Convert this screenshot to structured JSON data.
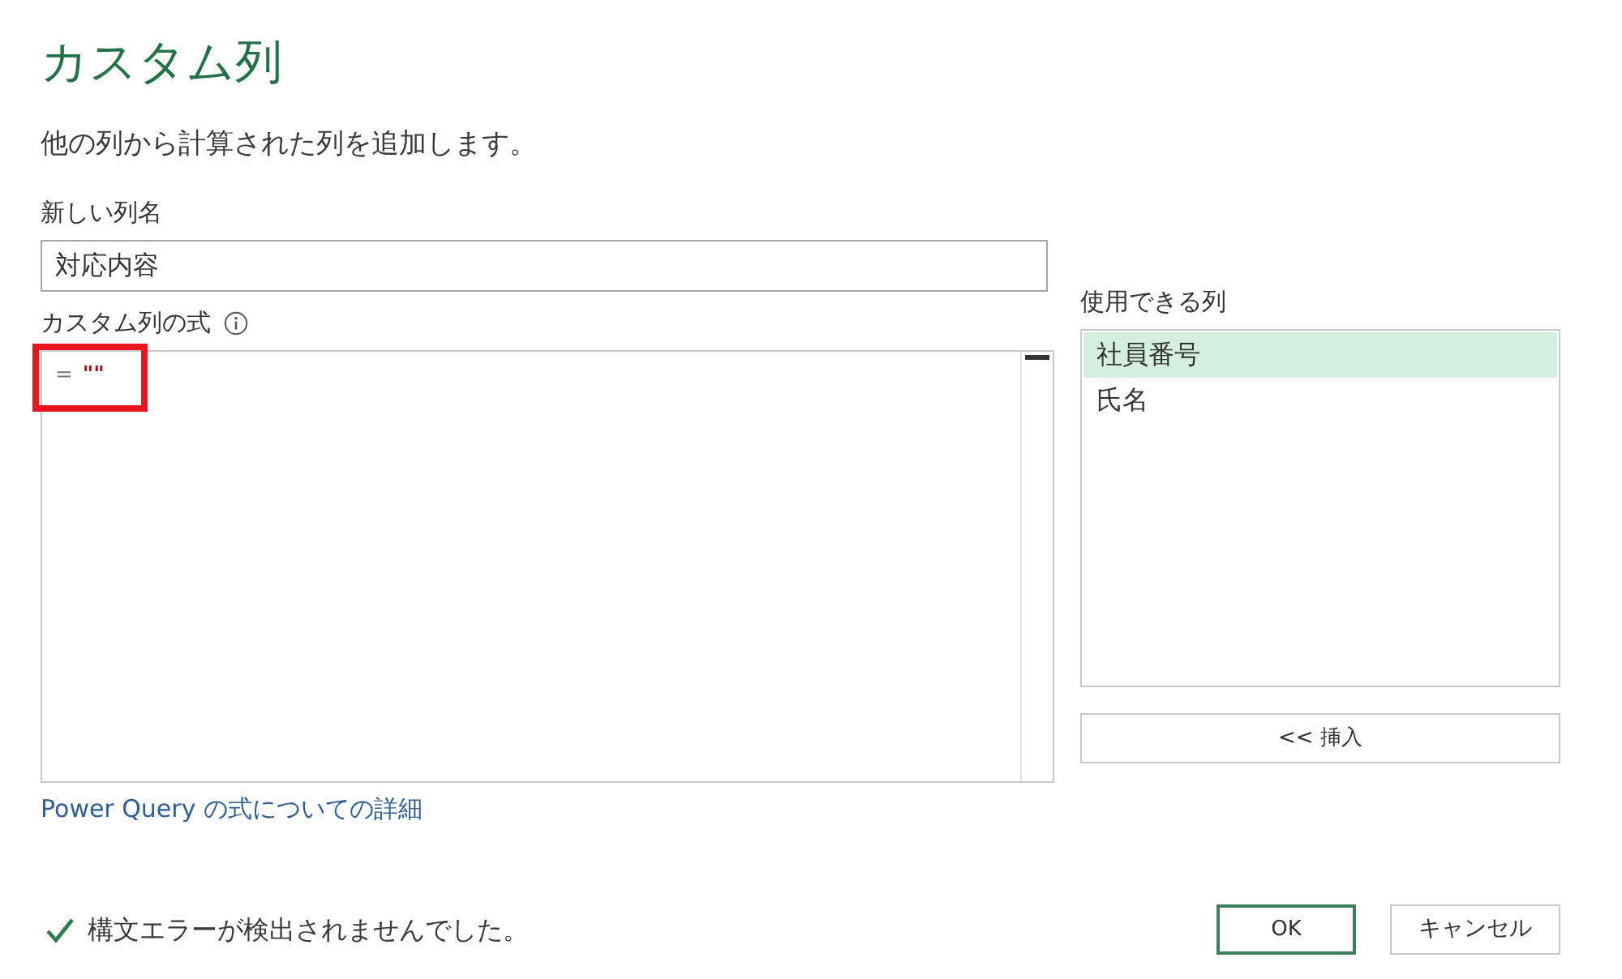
{
  "dialog": {
    "title": "カスタム列",
    "description": "他の列から計算された列を追加します。"
  },
  "new_column_name": {
    "label": "新しい列名",
    "value": "対応内容"
  },
  "formula": {
    "label": "カスタム列の式",
    "operator": "=",
    "literal": "\"\"",
    "highlighted": true
  },
  "available_columns": {
    "label": "使用できる列",
    "items": [
      {
        "label": "社員番号",
        "selected": true
      },
      {
        "label": "氏名",
        "selected": false
      }
    ]
  },
  "insert_button": "<< 挿入",
  "help_link": "Power Query の式についての詳細",
  "status": {
    "kind": "success",
    "message": "構文エラーが検出されませんでした。"
  },
  "buttons": [
    {
      "label": "OK",
      "primary": true
    },
    {
      "label": "キャンセル",
      "primary": false
    }
  ]
}
